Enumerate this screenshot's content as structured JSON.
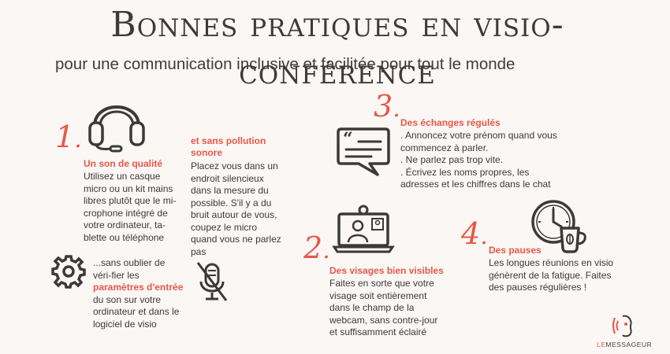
{
  "title": "Bonnes pratiques en visio-conférence",
  "subtitle": "pour une communication inclusive et facilitée pour tout le monde",
  "section1": {
    "number": "1",
    "heading": "Un son de qualité",
    "text": "Utilisez un casque micro ou un kit mains libres plutôt que le mi-crophone intégré de votre ordinateur, ta-blette ou téléphone",
    "icon": "headset-icon"
  },
  "section1b": {
    "heading_line1": "et sans pollution",
    "heading_line2": "sonore",
    "text": "Placez vous dans un endroit silencieux dans la mesure du possible. S'il y a du bruit autour de vous, coupez le micro quand vous ne parlez pas",
    "icon": "muted-microphone-icon"
  },
  "section1c": {
    "text_before": "...sans oublier de véri-fier les ",
    "text_highlight": "paramètres d'entrée",
    "text_after": " du son sur votre ordinateur et dans le logiciel de visio",
    "icon": "gear-icon"
  },
  "section2": {
    "number": "2",
    "heading": "Des visages bien visibles",
    "text": "Faites en sorte que votre visage soit entièrement dans le champ de la webcam, sans contre-jour et suffisamment éclairé",
    "icon": "webcam-laptop-icon"
  },
  "section3": {
    "number": "3",
    "heading": "Des échanges régulés",
    "bullets": [
      ". Annoncez votre prénom quand vous commencez à parler.",
      ". Ne parlez pas trop vite.",
      ". Écrivez les noms propres, les adresses et les chiffres dans le chat"
    ],
    "icon": "chat-bubble-icon"
  },
  "section4": {
    "number": "4",
    "heading": "Des pauses",
    "text": "Les longues réunions en visio génèrent de la fatigue. Faites des pauses régulières !",
    "icon": "clock-coffee-icon"
  },
  "logo": {
    "le": "LE",
    "rest": "MESSAGEUR"
  },
  "colors": {
    "accent": "#e8574a",
    "text": "#3a3a3a",
    "background": "#fbf7f4"
  }
}
